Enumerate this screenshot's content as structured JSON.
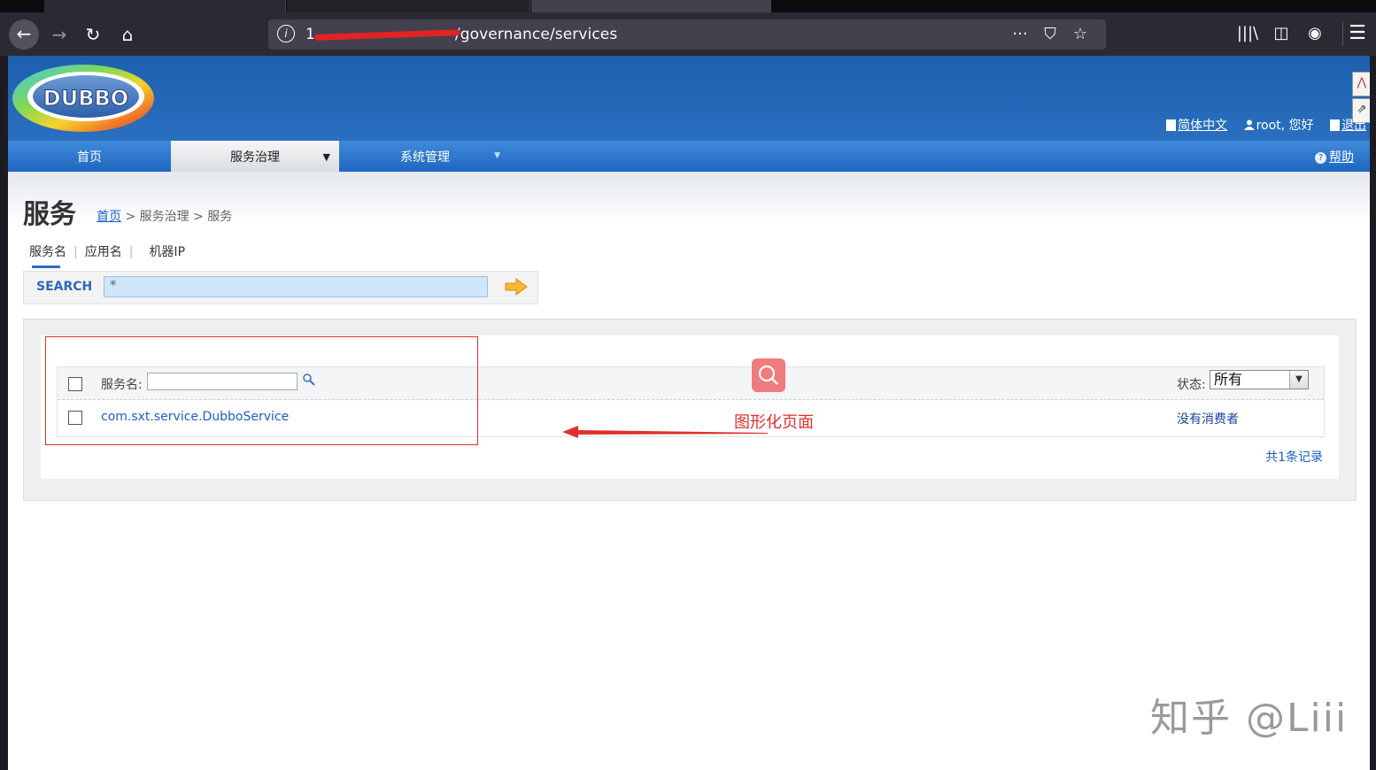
{
  "browser": {
    "url_visible": "1",
    "url_path": "/governance/services",
    "url_actions": [
      "···",
      "⛉",
      "☆"
    ],
    "toolbar_icons": [
      "|||\\",
      "◫",
      "◉"
    ],
    "menu": "☰"
  },
  "header": {
    "logo_text": "DUBBO",
    "language": "简体中文",
    "user": "root, 您好",
    "logout": "退出",
    "side_widgets": [
      "⋀",
      "⇗"
    ]
  },
  "nav": {
    "home": "首页",
    "governance": "服务治理",
    "governance_caret": "▼",
    "system": "系统管理",
    "system_caret": "▼",
    "help": "帮助",
    "help_icon": "?"
  },
  "page": {
    "title": "服务",
    "breadcrumb_home": "首页",
    "breadcrumb_rest": " > 服务治理 > 服务"
  },
  "search": {
    "tabs": [
      "服务名",
      "应用名",
      "机器IP"
    ],
    "separator": "|",
    "label": "SEARCH",
    "value": "*"
  },
  "table": {
    "filter_label": "服务名:",
    "status_label": "状态:",
    "status_value": "所有",
    "status_arrow": "▼",
    "rows": [
      {
        "service": "com.sxt.service.DubboService",
        "status": "没有消费者"
      }
    ],
    "records": "共1条记录"
  },
  "annotation": {
    "text": "图形化页面",
    "color": "#e0302c"
  },
  "watermark": "知乎 @Liii",
  "colors": {
    "header_blue": "#1e5fae",
    "nav_blue": "#3f8bdc",
    "link_blue": "#1c5ec4"
  }
}
